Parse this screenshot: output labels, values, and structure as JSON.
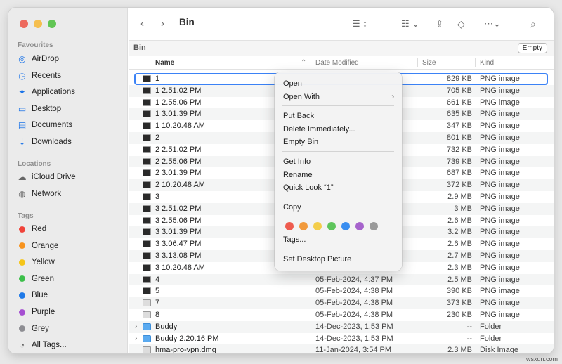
{
  "window": {
    "title": "Bin",
    "traffic_colors": [
      "#ed6a5e",
      "#f5bf4f",
      "#61c554"
    ]
  },
  "sidebar": {
    "favourites_header": "Favourites",
    "favourites": [
      {
        "label": "AirDrop",
        "icon": "airdrop-icon"
      },
      {
        "label": "Recents",
        "icon": "clock-icon"
      },
      {
        "label": "Applications",
        "icon": "applications-icon"
      },
      {
        "label": "Desktop",
        "icon": "desktop-icon"
      },
      {
        "label": "Documents",
        "icon": "document-icon"
      },
      {
        "label": "Downloads",
        "icon": "download-icon"
      }
    ],
    "locations_header": "Locations",
    "locations": [
      {
        "label": "iCloud Drive",
        "icon": "cloud-icon"
      },
      {
        "label": "Network",
        "icon": "globe-icon"
      }
    ],
    "tags_header": "Tags",
    "tags": [
      {
        "label": "Red",
        "color": "#f0433a"
      },
      {
        "label": "Orange",
        "color": "#f7931e"
      },
      {
        "label": "Yellow",
        "color": "#f5c518"
      },
      {
        "label": "Green",
        "color": "#3cbf4a"
      },
      {
        "label": "Blue",
        "color": "#1f7ae8"
      },
      {
        "label": "Purple",
        "color": "#a54fd1"
      },
      {
        "label": "Grey",
        "color": "#8e8e93"
      },
      {
        "label": "All Tags..."
      }
    ]
  },
  "pathbar": {
    "label": "Bin",
    "empty_button": "Empty"
  },
  "columns": {
    "name": "Name",
    "date": "Date Modified",
    "size": "Size",
    "kind": "Kind"
  },
  "files": [
    {
      "name": "1",
      "date": "",
      "size": "829 KB",
      "kind": "PNG image",
      "icon": "dark"
    },
    {
      "name": "1 2.51.02 PM",
      "date": "",
      "size": "705 KB",
      "kind": "PNG image",
      "icon": "dark"
    },
    {
      "name": "1 2.55.06 PM",
      "date": "",
      "size": "661 KB",
      "kind": "PNG image",
      "icon": "dark"
    },
    {
      "name": "1 3.01.39 PM",
      "date": "",
      "size": "635 KB",
      "kind": "PNG image",
      "icon": "dark"
    },
    {
      "name": "1 10.20.48 AM",
      "date": "",
      "size": "347 KB",
      "kind": "PNG image",
      "icon": "dark"
    },
    {
      "name": "2",
      "date": "",
      "size": "801 KB",
      "kind": "PNG image",
      "icon": "dark"
    },
    {
      "name": "2 2.51.02 PM",
      "date": "",
      "size": "732 KB",
      "kind": "PNG image",
      "icon": "dark"
    },
    {
      "name": "2 2.55.06 PM",
      "date": "",
      "size": "739 KB",
      "kind": "PNG image",
      "icon": "dark"
    },
    {
      "name": "2 3.01.39 PM",
      "date": "",
      "size": "687 KB",
      "kind": "PNG image",
      "icon": "dark"
    },
    {
      "name": "2 10.20.48 AM",
      "date": "",
      "size": "372 KB",
      "kind": "PNG image",
      "icon": "dark"
    },
    {
      "name": "3",
      "date": "",
      "size": "2.9 MB",
      "kind": "PNG image",
      "icon": "dark"
    },
    {
      "name": "3 2.51.02 PM",
      "date": "",
      "size": "3 MB",
      "kind": "PNG image",
      "icon": "dark"
    },
    {
      "name": "3 2.55.06 PM",
      "date": "",
      "size": "2.6 MB",
      "kind": "PNG image",
      "icon": "dark"
    },
    {
      "name": "3 3.01.39 PM",
      "date": "",
      "size": "3.2 MB",
      "kind": "PNG image",
      "icon": "dark"
    },
    {
      "name": "3 3.06.47 PM",
      "date": "",
      "size": "2.6 MB",
      "kind": "PNG image",
      "icon": "dark"
    },
    {
      "name": "3 3.13.08 PM",
      "date": "",
      "size": "2.7 MB",
      "kind": "PNG image",
      "icon": "dark"
    },
    {
      "name": "3 10.20.48 AM",
      "date": "",
      "size": "2.3 MB",
      "kind": "PNG image",
      "icon": "dark"
    },
    {
      "name": "4",
      "date": "05-Feb-2024, 4:37 PM",
      "size": "2.5 MB",
      "kind": "PNG image",
      "icon": "dark"
    },
    {
      "name": "5",
      "date": "05-Feb-2024, 4:38 PM",
      "size": "390 KB",
      "kind": "PNG image",
      "icon": "dark"
    },
    {
      "name": "7",
      "date": "05-Feb-2024, 4:38 PM",
      "size": "373 KB",
      "kind": "PNG image",
      "icon": "light"
    },
    {
      "name": "8",
      "date": "05-Feb-2024, 4:38 PM",
      "size": "230 KB",
      "kind": "PNG image",
      "icon": "light"
    },
    {
      "name": "Buddy",
      "date": "14-Dec-2023, 1:53 PM",
      "size": "--",
      "kind": "Folder",
      "icon": "folder"
    },
    {
      "name": "Buddy 2.20.16 PM",
      "date": "14-Dec-2023, 1:53 PM",
      "size": "--",
      "kind": "Folder",
      "icon": "folder"
    },
    {
      "name": "hma-pro-vpn.dmg",
      "date": "11-Jan-2024, 3:54 PM",
      "size": "2.3 MB",
      "kind": "Disk Image",
      "icon": "light"
    }
  ],
  "context_menu": {
    "items": [
      {
        "label": "Open"
      },
      {
        "label": "Open With",
        "submenu": true
      },
      {
        "separator": true
      },
      {
        "label": "Put Back"
      },
      {
        "label": "Delete Immediately..."
      },
      {
        "label": "Empty Bin"
      },
      {
        "separator": true
      },
      {
        "label": "Get Info"
      },
      {
        "label": "Rename"
      },
      {
        "label": "Quick Look “1”"
      },
      {
        "separator": true
      },
      {
        "label": "Copy"
      },
      {
        "separator": true
      },
      {
        "colors": true
      },
      {
        "label": "Tags..."
      },
      {
        "separator": true
      },
      {
        "label": "Set Desktop Picture"
      }
    ],
    "tag_colors": [
      "#ee5b4e",
      "#f19a3c",
      "#f3cd4a",
      "#5ec55c",
      "#3a8ef0",
      "#a663cc",
      "#9a9a9a"
    ]
  },
  "watermark": "wsxdn.com"
}
